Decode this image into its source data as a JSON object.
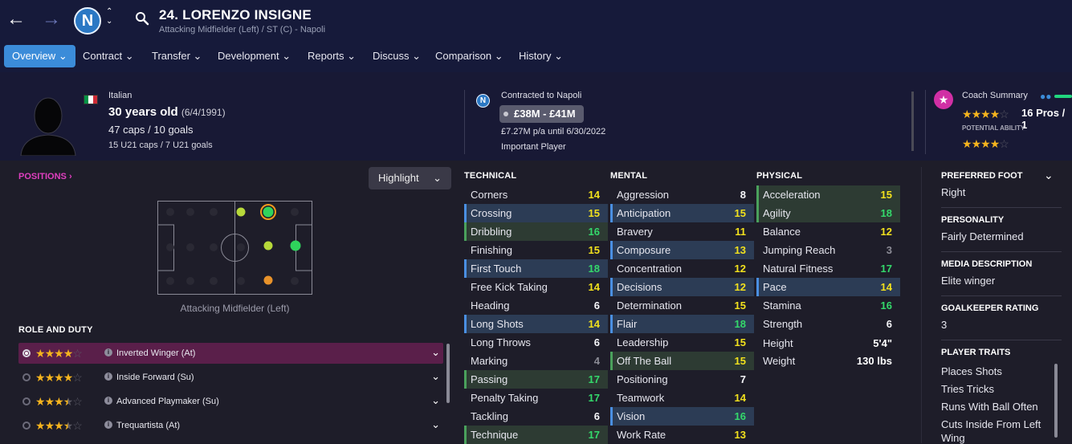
{
  "header": {
    "back_icon": "arrow-left-icon",
    "forward_icon": "arrow-right-icon",
    "club_badge_letter": "N",
    "player_name": "24. LORENZO INSIGNE",
    "player_subtitle": "Attacking Midfielder (Left) / ST (C) - Napoli"
  },
  "tabs": [
    {
      "label": "Overview"
    },
    {
      "label": "Contract"
    },
    {
      "label": "Transfer"
    },
    {
      "label": "Development"
    },
    {
      "label": "Reports"
    },
    {
      "label": "Discuss"
    },
    {
      "label": "Comparison"
    },
    {
      "label": "History"
    }
  ],
  "profile": {
    "nationality": "Italian",
    "age": "30 years old",
    "dob": "(6/4/1991)",
    "caps": "47 caps / 10 goals",
    "u21_caps": "15 U21 caps / 7 U21 goals",
    "flag_colors": [
      "#009246",
      "#ffffff",
      "#ce2b37"
    ]
  },
  "contract": {
    "badge_letter": "N",
    "contracted_to": "Contracted to Napoli",
    "value": "£38M - £41M",
    "wage": "£7.27M p/a until 6/30/2022",
    "status": "Important Player"
  },
  "coach": {
    "title": "Coach Summary",
    "current_ability_stars": 4,
    "pros": "16 Pros / 1",
    "potential_label": "POTENTIAL ABILITY",
    "potential_ability_stars": 4
  },
  "positions": {
    "link": "POSITIONS ›",
    "highlight_btn": "Highlight",
    "position_label": "Attacking Midfielder (Left)"
  },
  "roles": {
    "title": "ROLE AND DUTY",
    "items": [
      {
        "name": "Inverted Winger (At)",
        "stars": 4,
        "selected": true
      },
      {
        "name": "Inside Forward (Su)",
        "stars": 4,
        "selected": false
      },
      {
        "name": "Advanced Playmaker (Su)",
        "stars": 3.5,
        "selected": false
      },
      {
        "name": "Trequartista (At)",
        "stars": 3.5,
        "selected": false
      }
    ]
  },
  "technical": {
    "title": "TECHNICAL",
    "items": [
      {
        "name": "Corners",
        "value": 14,
        "hl": ""
      },
      {
        "name": "Crossing",
        "value": 15,
        "hl": "blue"
      },
      {
        "name": "Dribbling",
        "value": 16,
        "hl": "green"
      },
      {
        "name": "Finishing",
        "value": 15,
        "hl": ""
      },
      {
        "name": "First Touch",
        "value": 18,
        "hl": "blue"
      },
      {
        "name": "Free Kick Taking",
        "value": 14,
        "hl": ""
      },
      {
        "name": "Heading",
        "value": 6,
        "hl": ""
      },
      {
        "name": "Long Shots",
        "value": 14,
        "hl": "blue"
      },
      {
        "name": "Long Throws",
        "value": 6,
        "hl": ""
      },
      {
        "name": "Marking",
        "value": 4,
        "hl": ""
      },
      {
        "name": "Passing",
        "value": 17,
        "hl": "green"
      },
      {
        "name": "Penalty Taking",
        "value": 17,
        "hl": ""
      },
      {
        "name": "Tackling",
        "value": 6,
        "hl": ""
      },
      {
        "name": "Technique",
        "value": 17,
        "hl": "green"
      }
    ]
  },
  "mental": {
    "title": "MENTAL",
    "items": [
      {
        "name": "Aggression",
        "value": 8,
        "hl": ""
      },
      {
        "name": "Anticipation",
        "value": 15,
        "hl": "blue"
      },
      {
        "name": "Bravery",
        "value": 11,
        "hl": ""
      },
      {
        "name": "Composure",
        "value": 13,
        "hl": "blue"
      },
      {
        "name": "Concentration",
        "value": 12,
        "hl": ""
      },
      {
        "name": "Decisions",
        "value": 12,
        "hl": "blue"
      },
      {
        "name": "Determination",
        "value": 15,
        "hl": ""
      },
      {
        "name": "Flair",
        "value": 18,
        "hl": "blue"
      },
      {
        "name": "Leadership",
        "value": 15,
        "hl": ""
      },
      {
        "name": "Off The Ball",
        "value": 15,
        "hl": "green"
      },
      {
        "name": "Positioning",
        "value": 7,
        "hl": ""
      },
      {
        "name": "Teamwork",
        "value": 14,
        "hl": ""
      },
      {
        "name": "Vision",
        "value": 16,
        "hl": "blue"
      },
      {
        "name": "Work Rate",
        "value": 13,
        "hl": ""
      }
    ]
  },
  "physical": {
    "title": "PHYSICAL",
    "items": [
      {
        "name": "Acceleration",
        "value": 15,
        "hl": "green"
      },
      {
        "name": "Agility",
        "value": 18,
        "hl": "green"
      },
      {
        "name": "Balance",
        "value": 12,
        "hl": ""
      },
      {
        "name": "Jumping Reach",
        "value": 3,
        "hl": ""
      },
      {
        "name": "Natural Fitness",
        "value": 17,
        "hl": ""
      },
      {
        "name": "Pace",
        "value": 14,
        "hl": "blue"
      },
      {
        "name": "Stamina",
        "value": 16,
        "hl": ""
      },
      {
        "name": "Strength",
        "value": 6,
        "hl": ""
      }
    ],
    "height_label": "Height",
    "height": "5'4\"",
    "weight_label": "Weight",
    "weight": "130 lbs"
  },
  "info": {
    "foot_label": "PREFERRED FOOT",
    "foot": "Right",
    "personality_label": "PERSONALITY",
    "personality": "Fairly Determined",
    "media_label": "MEDIA DESCRIPTION",
    "media": "Elite winger",
    "gk_label": "GOALKEEPER RATING",
    "gk": "3",
    "traits_label": "PLAYER TRAITS",
    "traits": [
      "Places Shots",
      "Tries Tricks",
      "Runs With Ball Often",
      "Cuts Inside From Left",
      "Wing"
    ]
  },
  "colors": {
    "accent": "#3b8cd9",
    "magenta": "#e13fc0",
    "yellow_value": "#f2e11d",
    "green_value": "#34d96b"
  }
}
